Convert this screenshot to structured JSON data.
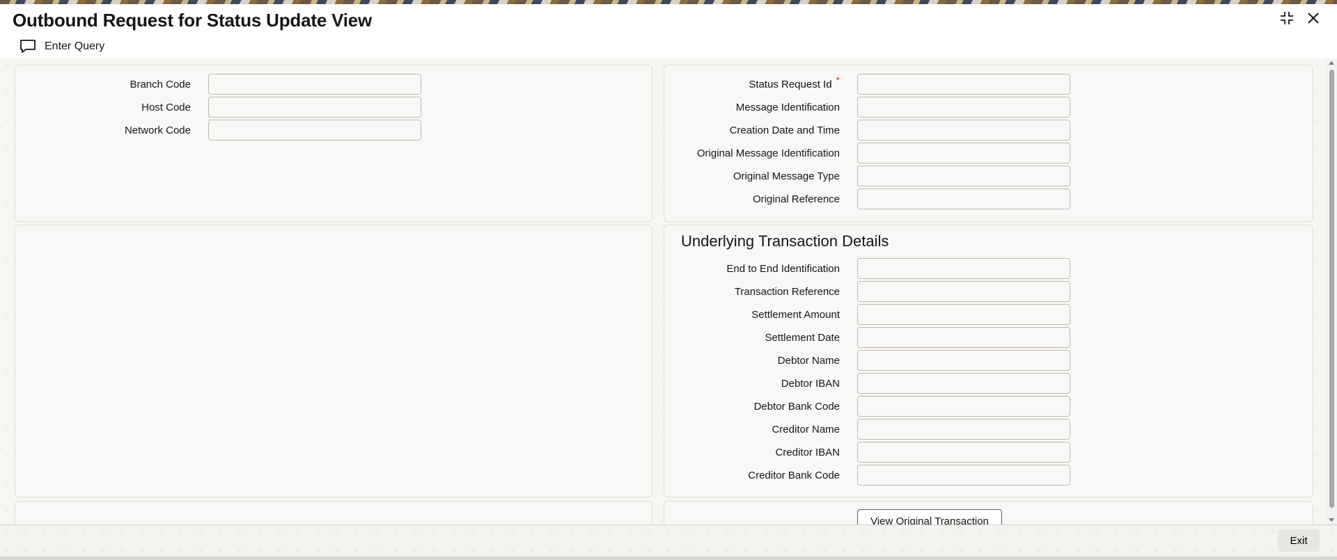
{
  "window": {
    "title": "Outbound Request for Status Update View",
    "icons": [
      "collapse-icon",
      "close-icon"
    ]
  },
  "toolbar": {
    "enter_query_label": "Enter Query",
    "enter_query_icon": "chat-bubble-icon"
  },
  "main_left": {
    "fields": [
      {
        "label": "Branch Code",
        "value": ""
      },
      {
        "label": "Host Code",
        "value": ""
      },
      {
        "label": "Network Code",
        "value": ""
      }
    ]
  },
  "main_right": {
    "fields": [
      {
        "label": "Status Request Id",
        "value": "",
        "required": "*"
      },
      {
        "label": "Message Identification",
        "value": ""
      },
      {
        "label": "Creation Date and Time",
        "value": ""
      },
      {
        "label": "Original Message Identification",
        "value": ""
      },
      {
        "label": "Original Message Type",
        "value": ""
      },
      {
        "label": "Original Reference",
        "value": ""
      }
    ]
  },
  "underlying": {
    "title": "Underlying Transaction Details",
    "fields": [
      {
        "label": "End to End Identification",
        "value": ""
      },
      {
        "label": "Transaction Reference",
        "value": ""
      },
      {
        "label": "Settlement Amount",
        "value": ""
      },
      {
        "label": "Settlement Date",
        "value": ""
      },
      {
        "label": "Debtor Name",
        "value": ""
      },
      {
        "label": "Debtor IBAN",
        "value": ""
      },
      {
        "label": "Debtor Bank Code",
        "value": ""
      },
      {
        "label": "Creditor Name",
        "value": ""
      },
      {
        "label": "Creditor IBAN",
        "value": ""
      },
      {
        "label": "Creditor Bank Code",
        "value": ""
      }
    ]
  },
  "actions": {
    "view_original_label": "View Original Transaction"
  },
  "footer": {
    "exit_label": "Exit"
  }
}
